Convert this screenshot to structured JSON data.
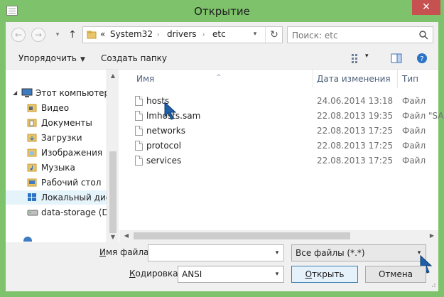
{
  "window": {
    "title": "Открытие",
    "close_glyph": "✕",
    "accent_color": "#7ec36b"
  },
  "address": {
    "back_glyph": "←",
    "forward_glyph": "→",
    "history_glyph": "▾",
    "up_glyph": "↑",
    "overflow": "«",
    "crumbs": [
      "System32",
      "drivers",
      "etc"
    ],
    "separator": "›",
    "dropdown_glyph": "▾",
    "refresh_glyph": "↻"
  },
  "search": {
    "placeholder": "Поиск: etc"
  },
  "toolbar": {
    "organize_label": "Упорядочить",
    "organize_arrow": "▼",
    "new_folder_label": "Создать папку",
    "view_arrow": "▾",
    "help_glyph": "?"
  },
  "nav": {
    "items": [
      {
        "label": "Этот компьютер",
        "icon": "computer-icon",
        "expander": "◢"
      },
      {
        "label": "Видео",
        "icon": "video-folder-icon"
      },
      {
        "label": "Документы",
        "icon": "documents-folder-icon"
      },
      {
        "label": "Загрузки",
        "icon": "downloads-folder-icon"
      },
      {
        "label": "Изображения",
        "icon": "pictures-folder-icon"
      },
      {
        "label": "Музыка",
        "icon": "music-folder-icon"
      },
      {
        "label": "Рабочий стол",
        "icon": "desktop-folder-icon"
      },
      {
        "label": "Локальный диск",
        "icon": "windows-drive-icon",
        "selected": true
      },
      {
        "label": "data-storage (D:)",
        "icon": "drive-icon"
      }
    ],
    "scroll_up": "▲",
    "scroll_down": "▼"
  },
  "files": {
    "columns": {
      "name": "Имя",
      "date": "Дата изменения",
      "type": "Тип"
    },
    "sort_glyph": "^",
    "rows": [
      {
        "name": "hosts",
        "date": "24.06.2014 13:18",
        "type": "Файл"
      },
      {
        "name": "lmhosts.sam",
        "date": "22.08.2013 19:35",
        "type": "Файл \"SA"
      },
      {
        "name": "networks",
        "date": "22.08.2013 17:25",
        "type": "Файл"
      },
      {
        "name": "protocol",
        "date": "22.08.2013 17:25",
        "type": "Файл"
      },
      {
        "name": "services",
        "date": "22.08.2013 17:25",
        "type": "Файл"
      }
    ],
    "scroll_left": "◀",
    "scroll_right": "▶"
  },
  "bottom": {
    "filename_label_u": "И",
    "filename_label_rest": "мя файла:",
    "filename_value": "",
    "filter_value": "Все файлы  (*.*)",
    "encoding_label_u": "К",
    "encoding_label_rest": "одировка:",
    "encoding_value": "ANSI",
    "open_u": "О",
    "open_rest": "ткрыть",
    "cancel_label": "Отмена",
    "dropdown_glyph": "▾"
  },
  "colors": {
    "cursor": "#1f5fa6",
    "folder": "#e8c46a"
  }
}
